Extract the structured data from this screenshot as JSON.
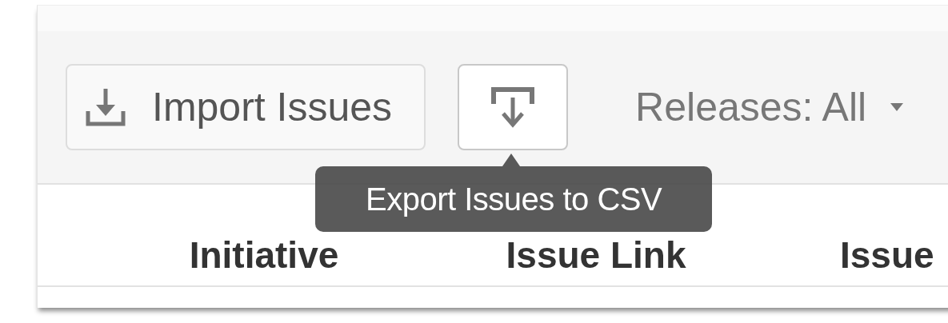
{
  "toolbar": {
    "import_button": {
      "label": "Import Issues"
    },
    "export_button": {
      "tooltip": "Export Issues to CSV"
    },
    "releases_filter": {
      "label": "Releases: All"
    }
  },
  "table": {
    "columns": [
      "Initiative",
      "Issue Link",
      "Issue"
    ]
  }
}
